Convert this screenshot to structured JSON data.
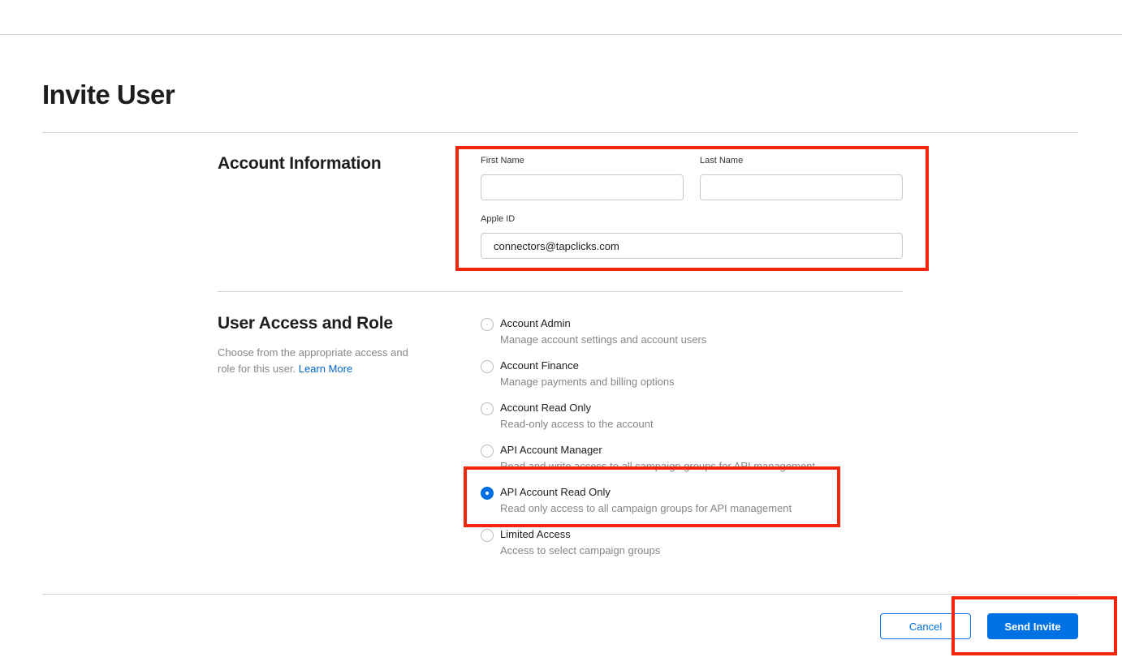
{
  "page": {
    "title": "Invite User"
  },
  "account_info": {
    "title": "Account Information",
    "first_name": {
      "label": "First Name",
      "value": ""
    },
    "last_name": {
      "label": "Last Name",
      "value": ""
    },
    "apple_id": {
      "label": "Apple ID",
      "value": "connectors@tapclicks.com"
    }
  },
  "access": {
    "title": "User Access and Role",
    "description": "Choose from the appropriate access and role for this user.",
    "learn_more": "Learn More",
    "roles": [
      {
        "name": "Account Admin",
        "desc": "Manage account settings and account users",
        "selected": false
      },
      {
        "name": "Account Finance",
        "desc": "Manage payments and billing options",
        "selected": false
      },
      {
        "name": "Account Read Only",
        "desc": "Read-only access to the account",
        "selected": false
      },
      {
        "name": "API Account Manager",
        "desc": "Read and write access to all campaign groups for API management",
        "selected": false
      },
      {
        "name": "API Account Read Only",
        "desc": "Read only access to all campaign groups for API management",
        "selected": true
      },
      {
        "name": "Limited Access",
        "desc": "Access to select campaign groups",
        "selected": false
      }
    ]
  },
  "footer": {
    "cancel_label": "Cancel",
    "send_label": "Send Invite"
  },
  "colors": {
    "accent": "#0071e3",
    "highlight": "#f0260f"
  }
}
